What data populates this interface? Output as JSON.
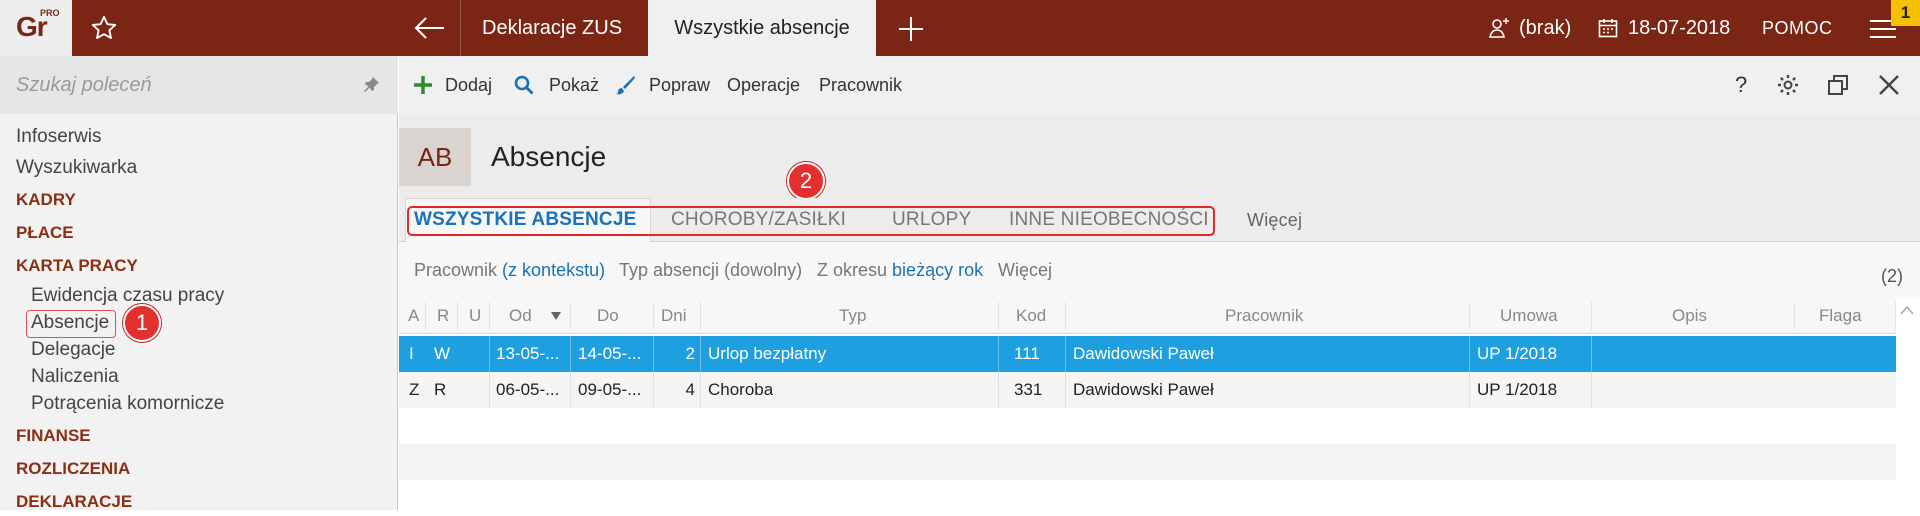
{
  "topbar": {
    "logo": "Gr",
    "logo_sup": "PRO",
    "tab1": "Deklaracje ZUS",
    "tab_active": "Wszystkie absencje",
    "user": "(brak)",
    "date": "18-07-2018",
    "help": "POMOC",
    "badge": "1"
  },
  "sidebar": {
    "search_placeholder": "Szukaj poleceń",
    "items": [
      {
        "label": "Infoserwis"
      },
      {
        "label": "Wyszukiwarka"
      }
    ],
    "sections": [
      "KADRY",
      "PŁACE",
      "KARTA PRACY",
      "FINANSE",
      "ROZLICZENIA",
      "DEKLARACJE"
    ],
    "karta_items": [
      "Ewidencja czasu pracy",
      "Absencje",
      "Delegacje",
      "Naliczenia",
      "Potrącenia komornicze"
    ],
    "callout": "1"
  },
  "toolbar": {
    "add": "Dodaj",
    "show": "Pokaż",
    "edit": "Popraw",
    "operations": "Operacje",
    "employee": "Pracownik",
    "help": "?"
  },
  "header": {
    "badge": "AB",
    "title": "Absencje",
    "callout": "2"
  },
  "tabs": [
    "WSZYSTKIE ABSENCJE",
    "CHOROBY/ZASIŁKI",
    "URLOPY",
    "INNE NIEOBECNOŚCI",
    "Więcej"
  ],
  "filters": {
    "employee_label": "Pracownik",
    "employee_value": "(z kontekstu)",
    "type": "Typ absencji (dowolny)",
    "period_label": "Z okresu",
    "period_value": "bieżący rok",
    "more": "Więcej",
    "count": "(2)"
  },
  "table": {
    "columns": [
      "A",
      "R",
      "U",
      "Od",
      "Do",
      "Dni",
      "Typ",
      "Kod",
      "Pracownik",
      "Umowa",
      "Opis",
      "Flaga"
    ],
    "rows": [
      {
        "a": "I",
        "r": "W",
        "u": "",
        "od": "13-05-...",
        "do": "14-05-...",
        "dni": "2",
        "typ": "Urlop bezpłatny",
        "kod": "111",
        "pracownik": "Dawidowski Paweł",
        "umowa": "UP 1/2018",
        "opis": "",
        "flaga": ""
      },
      {
        "a": "Z",
        "r": "R",
        "u": "",
        "od": "06-05-...",
        "do": "09-05-...",
        "dni": "4",
        "typ": "Choroba",
        "kod": "331",
        "pracownik": "Dawidowski Paweł",
        "umowa": "UP 1/2018",
        "opis": "",
        "flaga": ""
      }
    ]
  },
  "colors": {
    "brand": "#7b2614",
    "accent_blue": "#1a72b8",
    "selected_row": "#1ea0e0",
    "callout_red": "#e2302e",
    "badge_yellow": "#f5c000"
  }
}
